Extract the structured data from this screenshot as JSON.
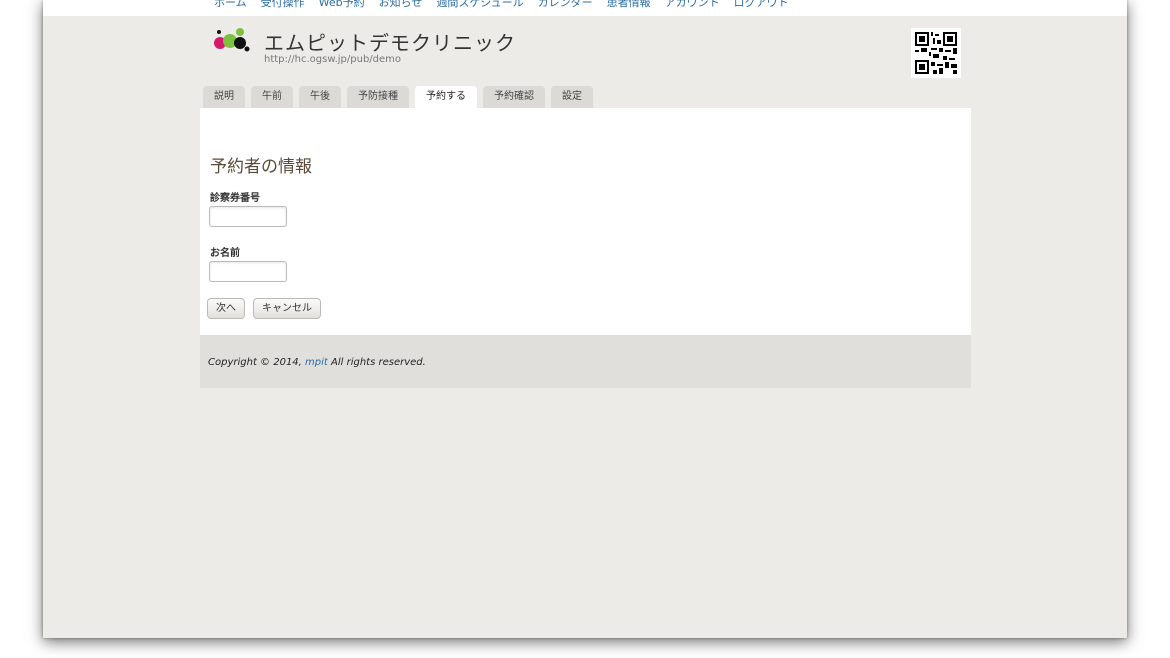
{
  "topnav": {
    "items": [
      "ホーム",
      "受付操作",
      "Web予約",
      "お知らせ",
      "週間スケジュール",
      "カレンダー",
      "患者情報",
      "アカウント",
      "ログアウト"
    ]
  },
  "header": {
    "title": "エムピットデモクリニック",
    "url": "http://hc.ogsw.jp/pub/demo"
  },
  "tabs": [
    {
      "label": "説明",
      "active": false
    },
    {
      "label": "午前",
      "active": false
    },
    {
      "label": "午後",
      "active": false
    },
    {
      "label": "予防接種",
      "active": false
    },
    {
      "label": "予約する",
      "active": true
    },
    {
      "label": "予約確認",
      "active": false
    },
    {
      "label": "設定",
      "active": false
    }
  ],
  "form": {
    "title": "予約者の情報",
    "card_number_label": "診察券番号",
    "card_number_value": "",
    "name_label": "お名前",
    "name_value": "",
    "next_button": "次へ",
    "cancel_button": "キャンセル"
  },
  "footer": {
    "prefix": "Copyright © 2014, ",
    "link": "mpit",
    "suffix": " All rights reserved."
  },
  "colors": {
    "link": "#2a6ca3",
    "logo_black": "#111111",
    "logo_pink": "#d6196e",
    "logo_green": "#7cc142"
  }
}
